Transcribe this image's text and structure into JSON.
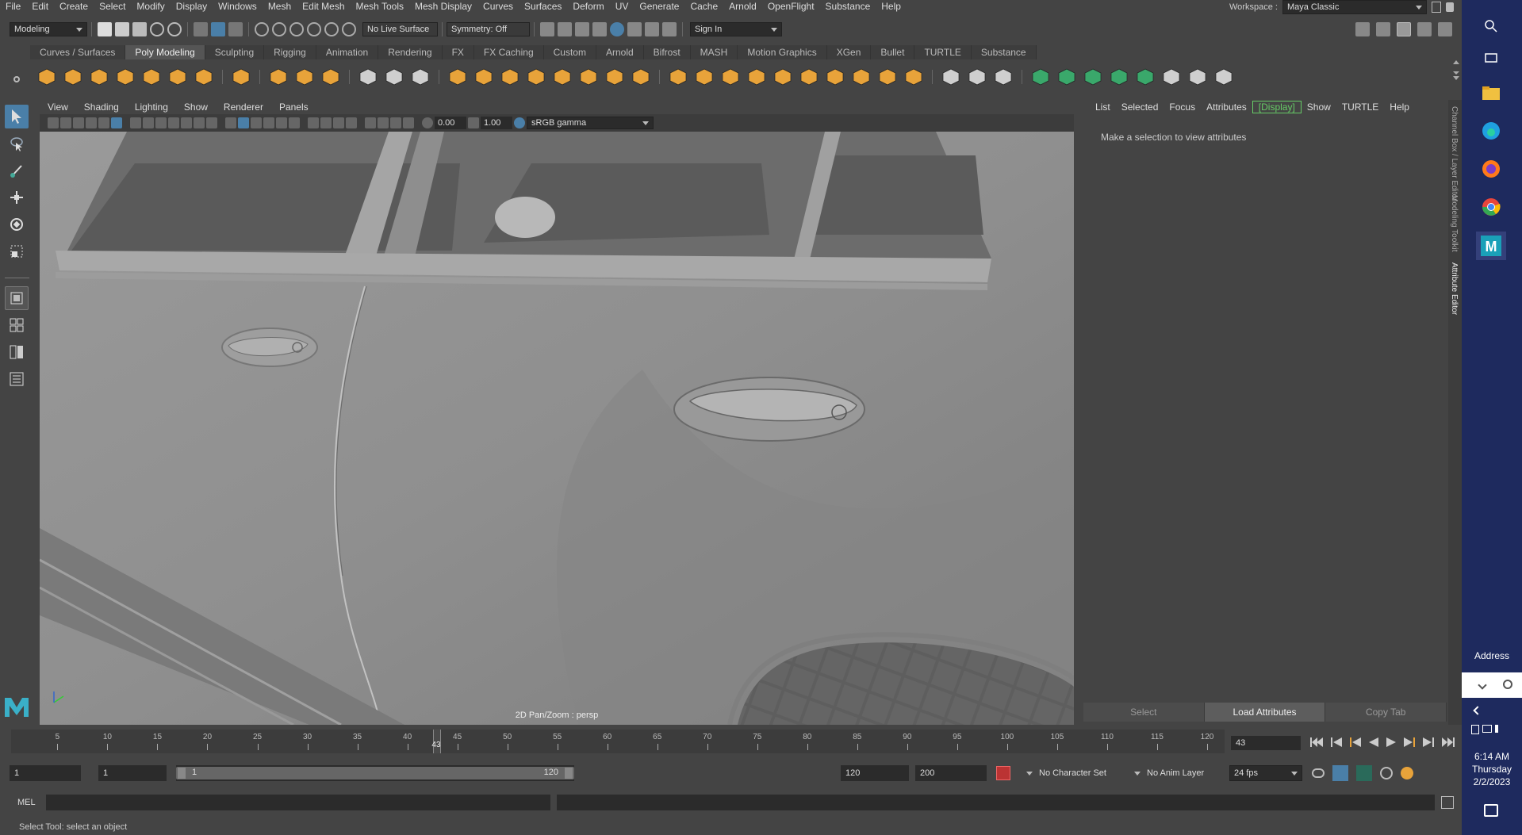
{
  "menubar": {
    "items": [
      "File",
      "Edit",
      "Create",
      "Select",
      "Modify",
      "Display",
      "Windows",
      "Mesh",
      "Edit Mesh",
      "Mesh Tools",
      "Mesh Display",
      "Curves",
      "Surfaces",
      "Deform",
      "UV",
      "Generate",
      "Cache",
      "Arnold",
      "OpenFlight",
      "Substance",
      "Help"
    ],
    "workspace_label": "Workspace :",
    "workspace_value": "Maya Classic"
  },
  "statusline": {
    "mode": "Modeling",
    "live_surface": "No Live Surface",
    "symmetry": "Symmetry: Off",
    "sign_in": "Sign In"
  },
  "shelf": {
    "tabs": [
      "Curves / Surfaces",
      "Poly Modeling",
      "Sculpting",
      "Rigging",
      "Animation",
      "Rendering",
      "FX",
      "FX Caching",
      "Custom",
      "Arnold",
      "Bifrost",
      "MASH",
      "Motion Graphics",
      "XGen",
      "Bullet",
      "TURTLE",
      "Substance"
    ],
    "active_tab": "Poly Modeling"
  },
  "viewport": {
    "menu": [
      "View",
      "Shading",
      "Lighting",
      "Show",
      "Renderer",
      "Panels"
    ],
    "exposure": "0.00",
    "gamma": "1.00",
    "color_space": "sRGB gamma",
    "camera_label": "2D Pan/Zoom : persp"
  },
  "attribute_editor": {
    "menu": [
      "List",
      "Selected",
      "Focus",
      "Attributes",
      "[Display]",
      "Show",
      "TURTLE",
      "Help"
    ],
    "message": "Make a selection to view attributes",
    "buttons": [
      "Select",
      "Load Attributes",
      "Copy Tab"
    ],
    "side_tabs": [
      "Channel Box / Layer Editor",
      "Modeling Toolkit",
      "Attribute Editor"
    ]
  },
  "timeline": {
    "ticks": [
      5,
      10,
      15,
      20,
      25,
      30,
      35,
      40,
      45,
      50,
      55,
      60,
      65,
      70,
      75,
      80,
      85,
      90,
      95,
      100,
      105,
      110,
      115,
      120
    ],
    "current_frame_marker": "43",
    "current_frame_field": "43",
    "current_frame": 43,
    "start": 1,
    "end": 120
  },
  "range": {
    "start_field": "1",
    "start_field2": "1",
    "slider_start": "1",
    "slider_end": "120",
    "end_field": "120",
    "end_field2": "200",
    "character_set": "No Character Set",
    "anim_layer": "No Anim Layer",
    "fps": "24 fps"
  },
  "command": {
    "language": "MEL"
  },
  "helpline": {
    "text": "Select Tool: select an object"
  },
  "taskbar": {
    "address_label": "Address",
    "time": "6:14 AM",
    "day": "Thursday",
    "date": "2/2/2023"
  },
  "colors": {
    "shelf_orange": "#e8a33a",
    "shelf_green": "#3aa86b",
    "highlight_green": "#66cc66",
    "taskbar_blue": "#1e2a5e"
  }
}
